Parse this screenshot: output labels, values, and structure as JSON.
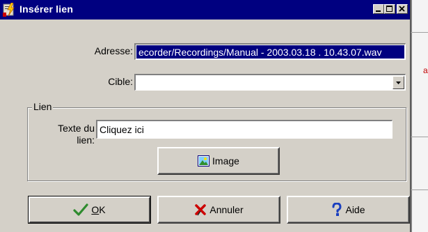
{
  "window": {
    "title": "Insérer lien"
  },
  "form": {
    "address_label": "Adresse:",
    "address_value": "ecorder/Recordings/Manual - 2003.03.18 . 10.43.07.wav",
    "target_label": "Cible:",
    "target_value": "",
    "group_label": "Lien",
    "link_text_label_line1": "Texte du",
    "link_text_label_line2": "lien:",
    "link_text_value": "Cliquez ici",
    "image_button": "Image"
  },
  "buttons": {
    "ok_mnemonic": "O",
    "ok_rest": "K",
    "cancel": "Annuler",
    "help": "Aide"
  },
  "background": {
    "glyph": "a"
  },
  "colors": {
    "titlebar": "#000080",
    "face": "#d4d0c8",
    "selection": "#000080",
    "ok_check": "#2e8b2e",
    "cancel_x": "#cc0000",
    "help_q": "#1a3fbf"
  },
  "icons": {
    "title": "lightning-link-icon",
    "image": "picture-icon",
    "ok": "checkmark-icon",
    "cancel": "red-x-icon",
    "help": "question-mark-icon"
  }
}
